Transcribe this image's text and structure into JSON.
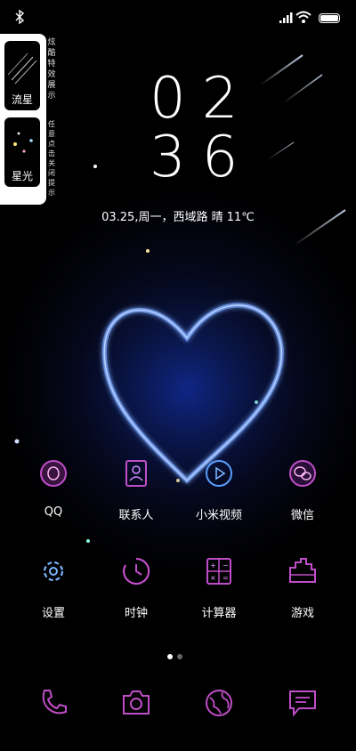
{
  "status_bar": {
    "icons": [
      "bluetooth-icon",
      "signal-icon",
      "wifi-icon",
      "battery-icon"
    ]
  },
  "effects_panel": {
    "items": [
      {
        "label": "流星",
        "icon": "meteor-icon"
      },
      {
        "label": "星光",
        "icon": "starlight-icon"
      }
    ],
    "title": "炫酷特效展示",
    "hint": "任意点击关闭提示"
  },
  "clock": {
    "hours": "02",
    "minutes": "36"
  },
  "date_line": "03.25,周一，西域路 晴 11℃",
  "apps_row1": [
    {
      "label": "QQ",
      "icon": "qq-icon"
    },
    {
      "label": "联系人",
      "icon": "contacts-icon"
    },
    {
      "label": "小米视频",
      "icon": "video-icon"
    },
    {
      "label": "微信",
      "icon": "wechat-icon"
    }
  ],
  "apps_row2": [
    {
      "label": "设置",
      "icon": "gear-icon"
    },
    {
      "label": "时钟",
      "icon": "clock-icon"
    },
    {
      "label": "计算器",
      "icon": "calculator-icon"
    },
    {
      "label": "游戏",
      "icon": "game-icon"
    }
  ],
  "page_indicator": {
    "pages": 2,
    "current": 1
  },
  "dock": [
    {
      "icon": "phone-icon"
    },
    {
      "icon": "camera-icon"
    },
    {
      "icon": "browser-icon"
    },
    {
      "icon": "message-icon"
    }
  ],
  "colors": {
    "neon_purple": "#c04ec8",
    "neon_blue": "#5aa0ff",
    "heart_glow": "#3a6dff"
  }
}
